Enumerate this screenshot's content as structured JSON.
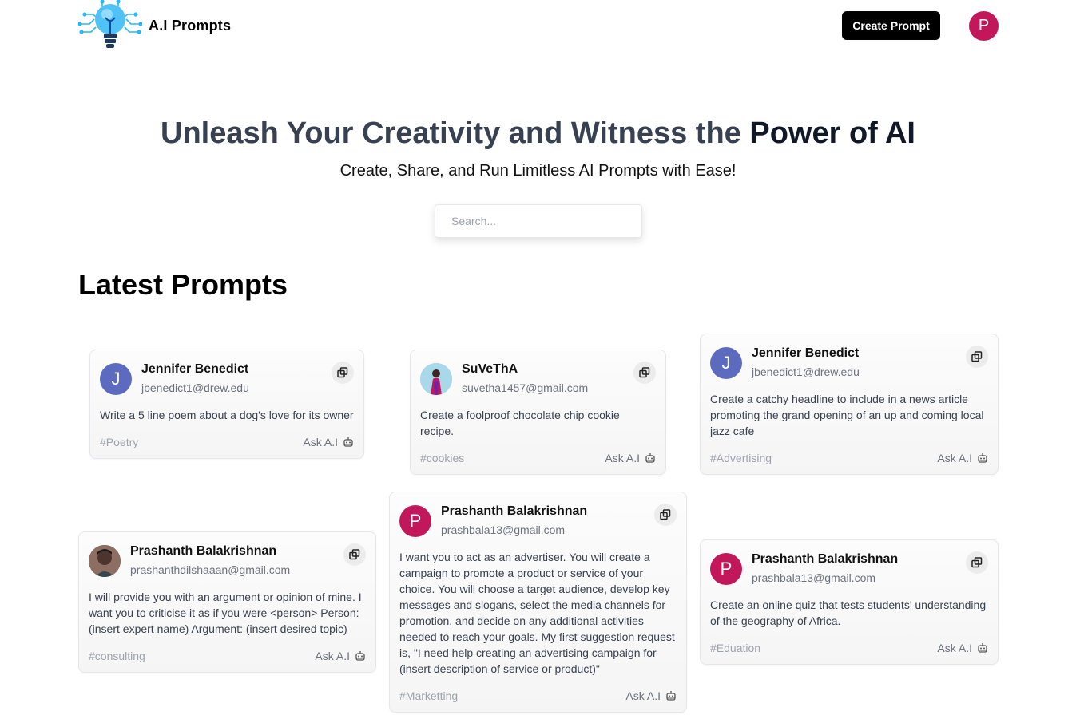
{
  "nav": {
    "brand": "A.I Prompts",
    "create_label": "Create Prompt",
    "user_initial": "P"
  },
  "hero": {
    "title_part1": "Unleash Your Creativity and Witness the",
    "title_part2": "Power of AI",
    "subtitle": "Create, Share, and Run Limitless AI Prompts with Ease!"
  },
  "search": {
    "placeholder": "Search..."
  },
  "section": {
    "title": "Latest Prompts"
  },
  "ask_label": "Ask A.I",
  "colors": {
    "accent_pink": "#c2185b",
    "accent_indigo": "#5c6bc0"
  },
  "cards": [
    {
      "name": "Jennifer Benedict",
      "email": "jbenedict1@drew.edu",
      "initial": "J",
      "avatar_color": "#5c6bc0",
      "text": "Write a 5 line poem about a dog's love for its owner",
      "tag": "#Poetry"
    },
    {
      "name": "SuVeThA",
      "email": "suvetha1457@gmail.com",
      "initial": "",
      "avatar_color": "#9ad1e6",
      "text": "Create a foolproof chocolate chip cookie recipe.",
      "tag": "#cookies"
    },
    {
      "name": "Jennifer Benedict",
      "email": "jbenedict1@drew.edu",
      "initial": "J",
      "avatar_color": "#5c6bc0",
      "text": "Create a catchy headline to include in a news article promoting the grand opening of an up and coming local jazz cafe",
      "tag": "#Advertising"
    },
    {
      "name": "Prashanth Balakrishnan",
      "email": "prashanthdilshaaan@gmail.com",
      "initial": "",
      "avatar_color": "#5b4a3c",
      "text": "I will provide you with an argument or opinion of mine. I want you to criticise it as if you were <person> Person: (insert expert name) Argument: (insert desired topic)",
      "tag": "#consulting"
    },
    {
      "name": "Prashanth Balakrishnan",
      "email": "prashbala13@gmail.com",
      "initial": "P",
      "avatar_color": "#c2185b",
      "text": "I want you to act as an advertiser. You will create a campaign to promote a product or service of your choice. You will choose a target audience, develop key messages and slogans, select the media channels for promotion, and decide on any additional activities needed to reach your goals. My first suggestion request is, \"I need help creating an advertising campaign for (insert description of service or product)\"",
      "tag": "#Marketting"
    },
    {
      "name": "Prashanth Balakrishnan",
      "email": "prashbala13@gmail.com",
      "initial": "P",
      "avatar_color": "#c2185b",
      "text": "Create an online quiz that tests students' understanding of the geography of Africa.",
      "tag": "#Eduation"
    }
  ]
}
